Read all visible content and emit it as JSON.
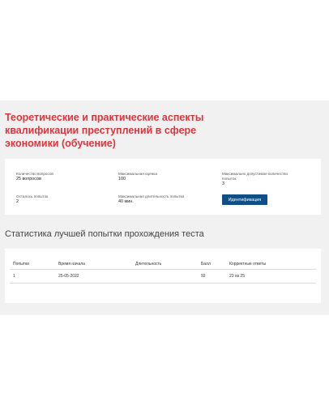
{
  "course_title": "Теоретические и практические аспекты квалификации преступлений в сфере экономики (обучение)",
  "info": {
    "questions_label": "Количество вопросов",
    "questions_value": "25 вопросов",
    "max_score_label": "Максимальная оценка",
    "max_score_value": "100",
    "max_attempts_label": "Максимально допустимое количество попыток",
    "max_attempts_value": "3",
    "remaining_label": "Осталось попыток",
    "remaining_value": "2",
    "max_duration_label": "Максимальная длительность попытки",
    "max_duration_value": "40 мин.",
    "identify_button": "Идентификация"
  },
  "stats": {
    "title": "Статистика лучшей попытки прохождения теста",
    "headers": [
      "Попытки",
      "Время начала",
      "Длительность",
      "Балл",
      "Корректные ответы"
    ],
    "rows": [
      [
        "1",
        "25-05-2022",
        "",
        "92",
        "23 из 25"
      ]
    ]
  },
  "colors": {
    "title": "#d9363e",
    "button": "#0f4f86",
    "panel": "#f1f1f1"
  }
}
